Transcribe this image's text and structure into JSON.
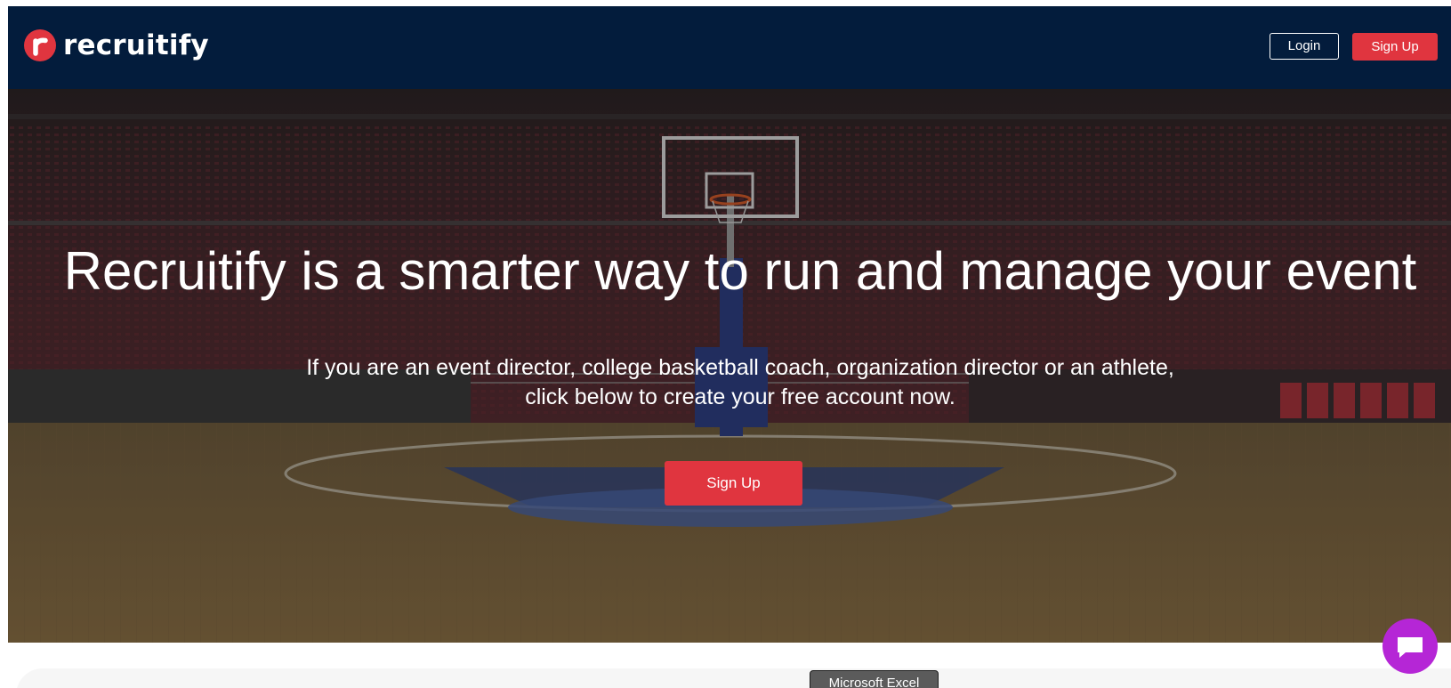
{
  "brand": {
    "logo_letter": "r",
    "name": "recruitify",
    "color": "#e0353f"
  },
  "nav": {
    "login_label": "Login",
    "signup_label": "Sign Up",
    "background": "#031c3c"
  },
  "hero": {
    "title": "Recruitify is a smarter way to run and manage your event",
    "subtitle_line1": "If you are an event director, college basketball coach, organization director or an athlete,",
    "subtitle_line2": "click below to create your free account now.",
    "cta_label": "Sign Up",
    "background_image": "basketball-arena-photo"
  },
  "tooltip": {
    "text": "Microsoft Excel"
  },
  "chat": {
    "icon": "chat-icon",
    "color": "#b526d6"
  }
}
